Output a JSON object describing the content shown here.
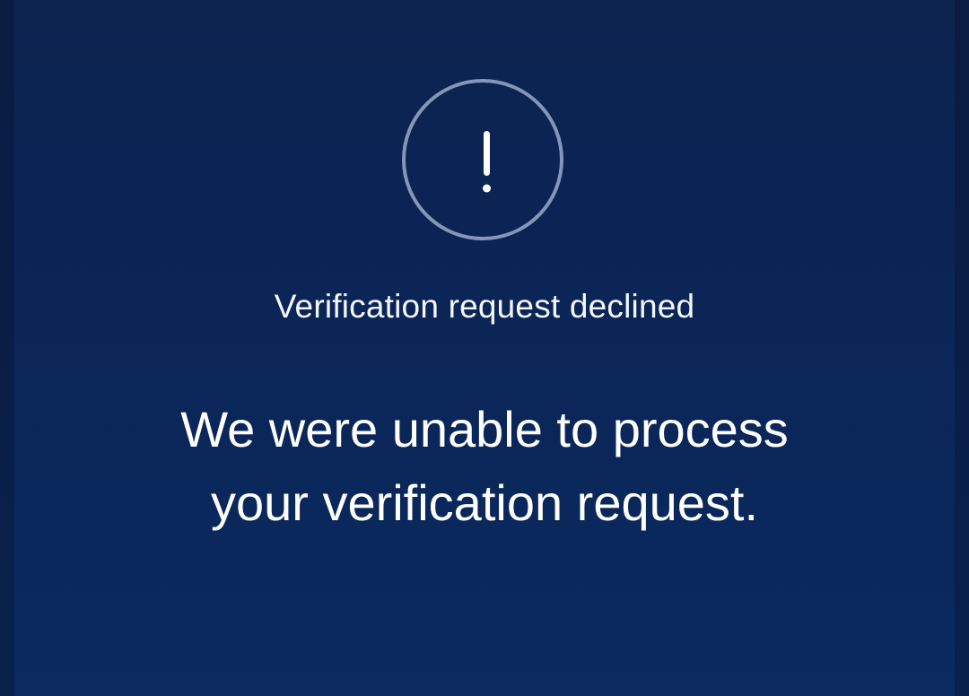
{
  "status": {
    "icon": "exclamation-circle-icon",
    "title": "Verification request declined"
  },
  "message": {
    "line1": "We were unable to process",
    "line2": "your verification request."
  },
  "colors": {
    "background": "#0b2556",
    "ring": "#8497b8",
    "text": "#ffffff"
  }
}
